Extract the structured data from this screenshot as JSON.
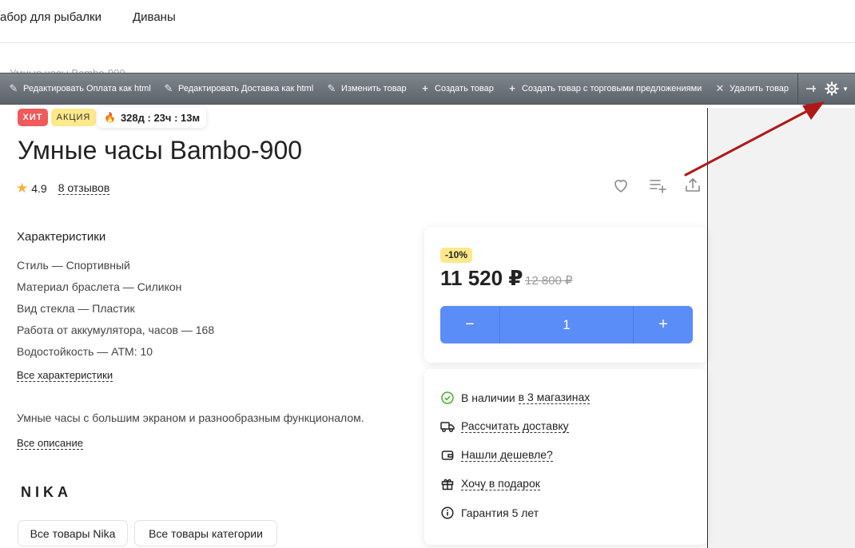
{
  "nav": {
    "items": [
      "абор для рыбалки",
      "Диваны"
    ]
  },
  "breadcrumb": "Умные часы Bambo-900",
  "admin_bar": {
    "buttons": [
      "Редактировать Оплата как html",
      "Редактировать Доставка как html",
      "Изменить товар",
      "Создать товар",
      "Создать товар с торговыми предложениями",
      "Удалить товар"
    ],
    "icons": [
      "pencil-icon",
      "pencil-icon",
      "pencil-icon",
      "plus-icon",
      "plus-icon",
      "close-icon",
      "pin-icon",
      "gear-icon",
      "chevron-down-icon"
    ]
  },
  "product": {
    "badges": {
      "hit": "ХИТ",
      "sale": "АКЦИЯ"
    },
    "timer": "328д : 23ч : 13м",
    "title": "Умные часы Bambo-900",
    "rating": "4.9",
    "reviews": "8 отзывов"
  },
  "characteristics": {
    "heading": "Характеристики",
    "rows": [
      "Стиль — Спортивный",
      "Материал браслета — Силикон",
      "Вид стекла — Пластик",
      "Работа от аккумулятора, часов — 168",
      "Водостойкость — ATM: 10"
    ],
    "all_link": "Все характеристики"
  },
  "description": {
    "text": "Умные часы с большим экраном и разнообразным функционалом.",
    "all_link": "Все описание"
  },
  "brand": {
    "logo": "NIKA",
    "btn_all_brand": "Все товары Nika",
    "btn_all_category": "Все товары категории"
  },
  "price_card": {
    "discount": "-10%",
    "price": "11 520 ₽",
    "old_price": "12 800 ₽",
    "quantity": "1",
    "minus": "−",
    "plus": "+"
  },
  "info_card": {
    "availability_prefix": "В наличии",
    "availability_link": "в 3 магазинах",
    "delivery": "Рассчитать доставку",
    "cheaper": "Нашли дешевле?",
    "gift": "Хочу в подарок",
    "warranty": "Гарантия 5 лет"
  },
  "colors": {
    "accent": "#5b8df9",
    "hit_badge": "#f05a5a",
    "sale_badge": "#fde88a",
    "admin_bar": "#6a7078",
    "annotation_arrow": "#b01818",
    "in_stock": "#43b02a"
  }
}
